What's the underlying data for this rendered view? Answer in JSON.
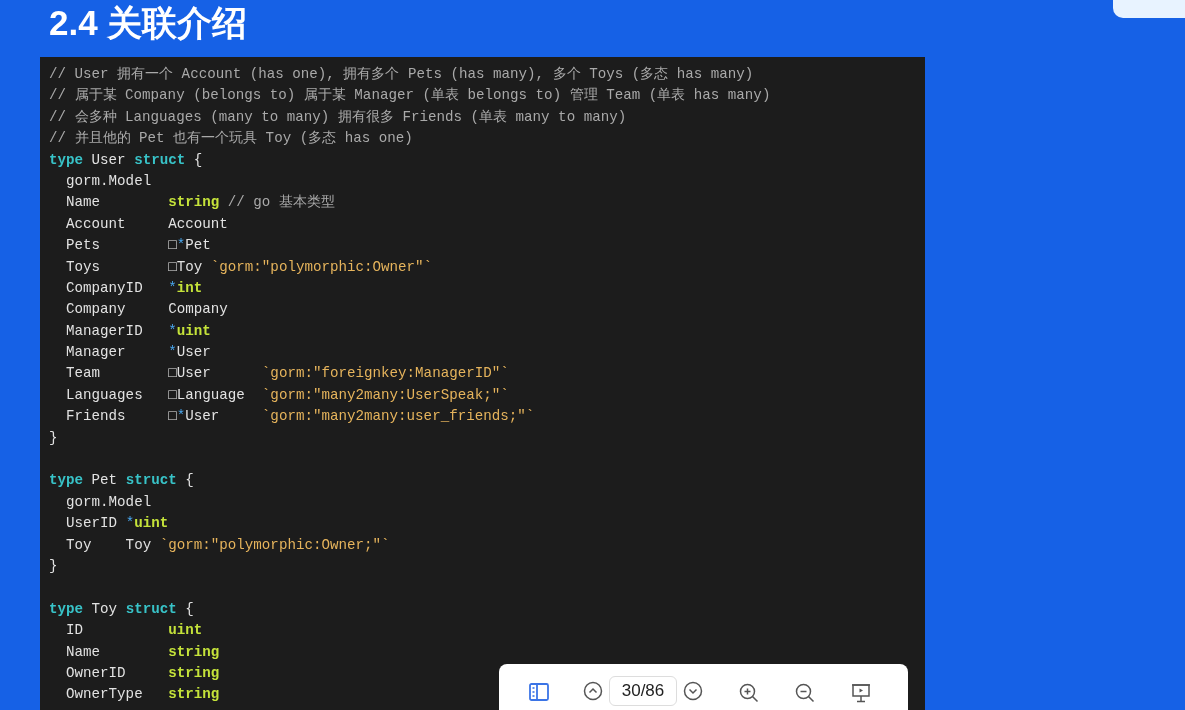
{
  "slide": {
    "title": "2.4 关联介绍",
    "code": {
      "blocks": [
        {
          "lines": [
            [
              {
                "kind": "comment",
                "text": "// User 拥有一个 Account (has one), 拥有多个 Pets (has many), 多个 Toys (多态 has many)"
              }
            ],
            [
              {
                "kind": "comment",
                "text": "// 属于某 Company (belongs to) 属于某 Manager (单表 belongs to) 管理 Team (单表 has many)"
              }
            ],
            [
              {
                "kind": "comment",
                "text": "// 会多种 Languages (many to many) 拥有很多 Friends (单表 many to many)"
              }
            ],
            [
              {
                "kind": "comment",
                "text": "// 并且他的 Pet 也有一个玩具 Toy (多态 has one)"
              }
            ],
            [
              {
                "kind": "keyword",
                "text": "type"
              },
              {
                "kind": "plain",
                "text": " User "
              },
              {
                "kind": "keyword",
                "text": "struct"
              },
              {
                "kind": "plain",
                "text": " {"
              }
            ],
            [
              {
                "kind": "plain",
                "text": "  gorm.Model"
              }
            ],
            [
              {
                "kind": "plain",
                "text": "  Name        "
              },
              {
                "kind": "builtin",
                "text": "string"
              },
              {
                "kind": "comment",
                "text": " // go 基本类型"
              }
            ],
            [
              {
                "kind": "plain",
                "text": "  Account     Account"
              }
            ],
            [
              {
                "kind": "plain",
                "text": "  Pets        □"
              },
              {
                "kind": "pointer",
                "text": "*"
              },
              {
                "kind": "plain",
                "text": "Pet"
              }
            ],
            [
              {
                "kind": "plain",
                "text": "  Toys        □Toy "
              },
              {
                "kind": "tag",
                "text": "`gorm:\"polymorphic:Owner\"`"
              }
            ],
            [
              {
                "kind": "plain",
                "text": "  CompanyID   "
              },
              {
                "kind": "pointer",
                "text": "*"
              },
              {
                "kind": "builtin",
                "text": "int"
              }
            ],
            [
              {
                "kind": "plain",
                "text": "  Company     Company"
              }
            ],
            [
              {
                "kind": "plain",
                "text": "  ManagerID   "
              },
              {
                "kind": "pointer",
                "text": "*"
              },
              {
                "kind": "builtin",
                "text": "uint"
              }
            ],
            [
              {
                "kind": "plain",
                "text": "  Manager     "
              },
              {
                "kind": "pointer",
                "text": "*"
              },
              {
                "kind": "plain",
                "text": "User"
              }
            ],
            [
              {
                "kind": "plain",
                "text": "  Team        □User      "
              },
              {
                "kind": "tag",
                "text": "`gorm:\"foreignkey:ManagerID\"`"
              }
            ],
            [
              {
                "kind": "plain",
                "text": "  Languages   □Language  "
              },
              {
                "kind": "tag",
                "text": "`gorm:\"many2many:UserSpeak;\"`"
              }
            ],
            [
              {
                "kind": "plain",
                "text": "  Friends     □"
              },
              {
                "kind": "pointer",
                "text": "*"
              },
              {
                "kind": "plain",
                "text": "User     "
              },
              {
                "kind": "tag",
                "text": "`gorm:\"many2many:user_friends;\"`"
              }
            ],
            [
              {
                "kind": "plain",
                "text": "}"
              }
            ]
          ]
        },
        {
          "lines": [
            [
              {
                "kind": "keyword",
                "text": "type"
              },
              {
                "kind": "plain",
                "text": " Pet "
              },
              {
                "kind": "keyword",
                "text": "struct"
              },
              {
                "kind": "plain",
                "text": " {"
              }
            ],
            [
              {
                "kind": "plain",
                "text": "  gorm.Model"
              }
            ],
            [
              {
                "kind": "plain",
                "text": "  UserID "
              },
              {
                "kind": "pointer",
                "text": "*"
              },
              {
                "kind": "builtin",
                "text": "uint"
              }
            ],
            [
              {
                "kind": "plain",
                "text": "  Toy    Toy "
              },
              {
                "kind": "tag",
                "text": "`gorm:\"polymorphic:Owner;\"`"
              }
            ],
            [
              {
                "kind": "plain",
                "text": "}"
              }
            ]
          ]
        },
        {
          "lines": [
            [
              {
                "kind": "keyword",
                "text": "type"
              },
              {
                "kind": "plain",
                "text": " Toy "
              },
              {
                "kind": "keyword",
                "text": "struct"
              },
              {
                "kind": "plain",
                "text": " {"
              }
            ],
            [
              {
                "kind": "plain",
                "text": "  ID          "
              },
              {
                "kind": "builtin",
                "text": "uint"
              }
            ],
            [
              {
                "kind": "plain",
                "text": "  Name        "
              },
              {
                "kind": "builtin",
                "text": "string"
              }
            ],
            [
              {
                "kind": "plain",
                "text": "  OwnerID     "
              },
              {
                "kind": "builtin",
                "text": "string"
              }
            ],
            [
              {
                "kind": "plain",
                "text": "  OwnerType   "
              },
              {
                "kind": "builtin",
                "text": "string"
              }
            ]
          ]
        }
      ]
    }
  },
  "toolbar": {
    "page": "30/86"
  }
}
